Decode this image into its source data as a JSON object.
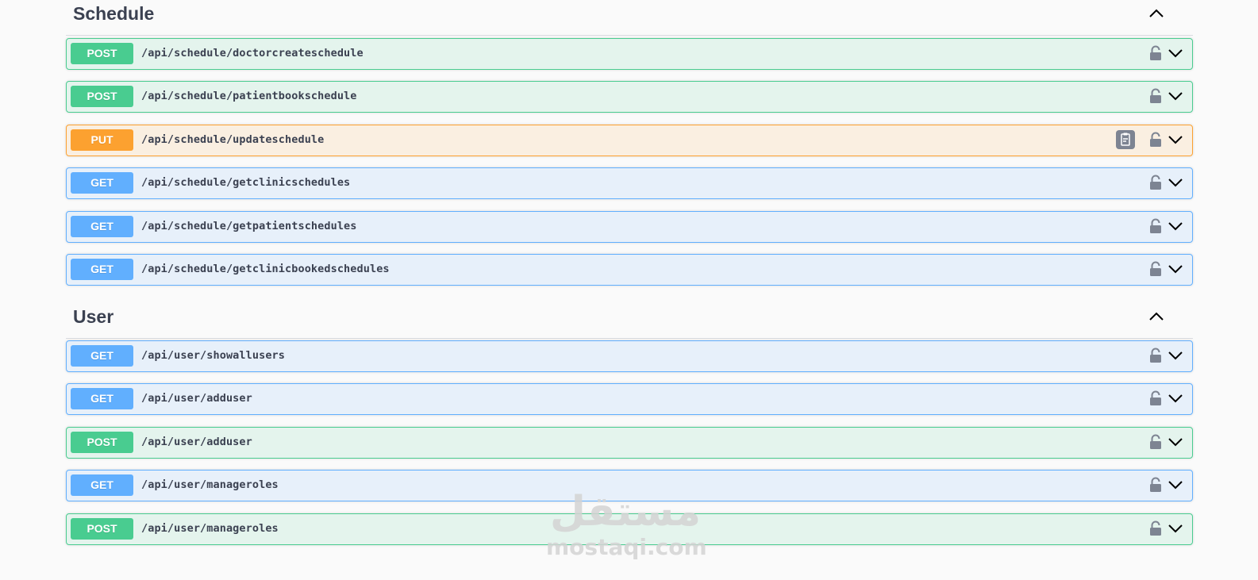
{
  "sections": [
    {
      "title": "Schedule",
      "operations": [
        {
          "method": "POST",
          "path": "/api/schedule/doctorcreateschedule"
        },
        {
          "method": "POST",
          "path": "/api/schedule/patientbookschedule"
        },
        {
          "method": "PUT",
          "path": "/api/schedule/updateschedule"
        },
        {
          "method": "GET",
          "path": "/api/schedule/getclinicschedules"
        },
        {
          "method": "GET",
          "path": "/api/schedule/getpatientschedules"
        },
        {
          "method": "GET",
          "path": "/api/schedule/getclinicbookedschedules"
        }
      ]
    },
    {
      "title": "User",
      "operations": [
        {
          "method": "GET",
          "path": "/api/user/showallusers"
        },
        {
          "method": "GET",
          "path": "/api/user/adduser"
        },
        {
          "method": "POST",
          "path": "/api/user/adduser"
        },
        {
          "method": "GET",
          "path": "/api/user/manageroles"
        },
        {
          "method": "POST",
          "path": "/api/user/manageroles"
        }
      ]
    }
  ],
  "watermark": {
    "arabic": "مستقل",
    "latin": "mostaqi.com"
  },
  "colors": {
    "post": "#49cc90",
    "put": "#fca130",
    "get": "#61affe",
    "title": "#3b4151"
  },
  "icons": {
    "section_toggle": "chevron-up-icon",
    "lock": "lock-icon",
    "expand": "chevron-down-icon",
    "copy": "clipboard-icon"
  }
}
